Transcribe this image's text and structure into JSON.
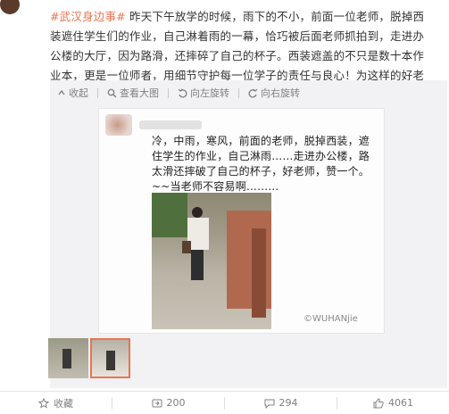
{
  "post": {
    "hashtag": "#武汉身边事#",
    "text": " 昨天下午放学的时候，雨下的不小，前面一位老师，脱掉西装遮住学生们的作业，自己淋着雨的一幕，恰巧被后面老师抓拍到，走进办公楼的大厅，因为路滑，还摔碎了自己的杯子。西装遮盖的不只是数十本作业本，更是一位师者，用细节守护每一位学子的责任与良心！为这样的好老师点赞。"
  },
  "toolbar": {
    "collapse": "收起",
    "view_large": "查看大图",
    "rotate_left": "向左旋转",
    "rotate_right": "向右旋转"
  },
  "image_post": {
    "text": "冷，中雨，寒风，前面的老师，脱掉西装，遮住学生的作业，自己淋雨……走进办公楼，路太滑还摔破了自己的杯子，好老师，赞一个。~~当老师不容易啊………",
    "watermark": "©WUHANjie"
  },
  "footer": {
    "favorite": "收藏",
    "repost_count": "200",
    "comment_count": "294",
    "like_count": "4061"
  }
}
